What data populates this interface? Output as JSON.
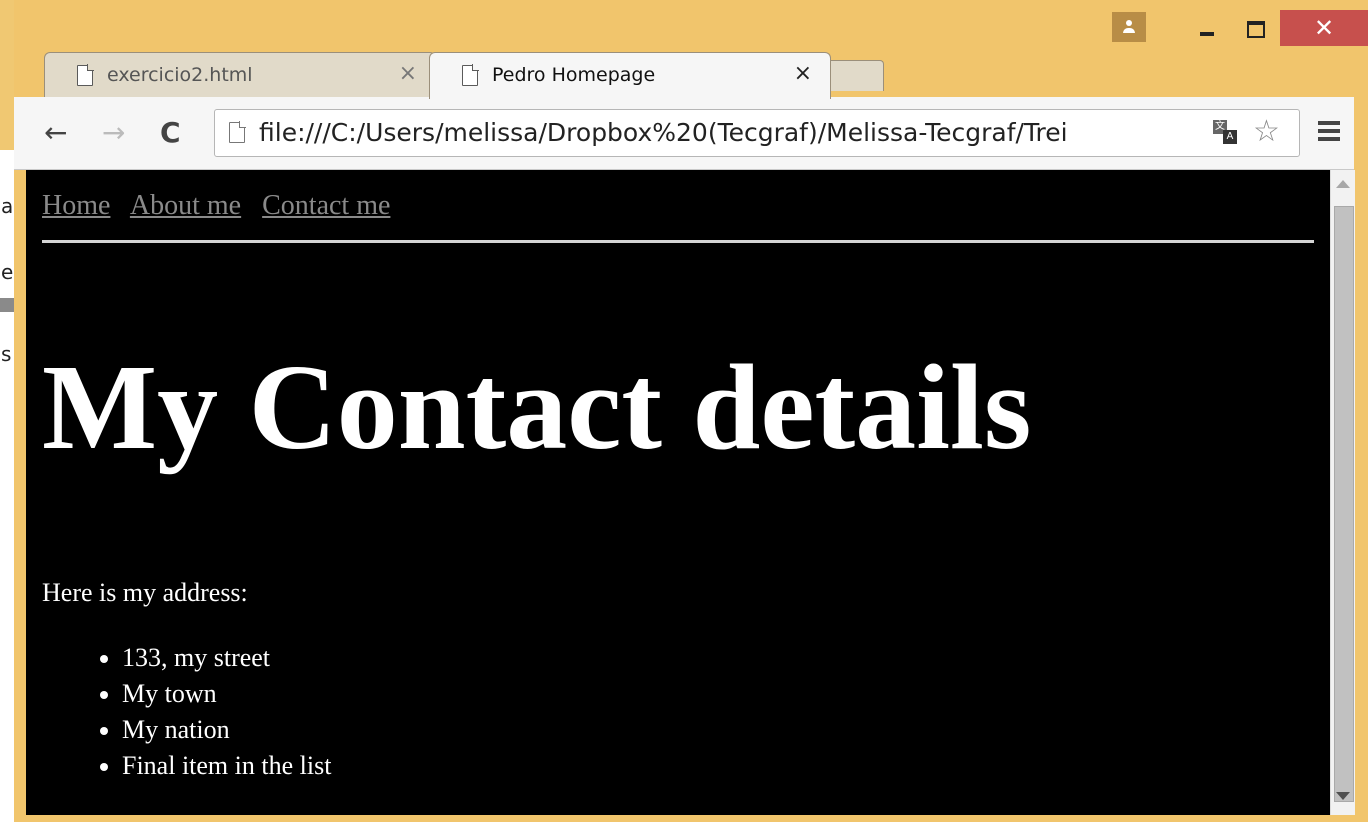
{
  "background_window": {
    "fragments": [
      "a",
      "e",
      "s"
    ]
  },
  "tabs": [
    {
      "title": "exercicio2.html",
      "close": "×"
    },
    {
      "title": "Pedro Homepage",
      "close": "×"
    }
  ],
  "toolbar": {
    "back": "←",
    "forward": "→",
    "reload": "C",
    "url": "file:///C:/Users/melissa/Dropbox%20(Tecgraf)/Melissa-Tecgraf/Trei",
    "star": "☆"
  },
  "window_controls": {
    "close": "✕"
  },
  "page": {
    "nav": [
      "Home",
      "About me",
      "Contact me"
    ],
    "heading": "My Contact details",
    "intro": "Here is my address:",
    "address": [
      "133, my street",
      "My town",
      "My nation",
      "Final item in the list"
    ]
  }
}
